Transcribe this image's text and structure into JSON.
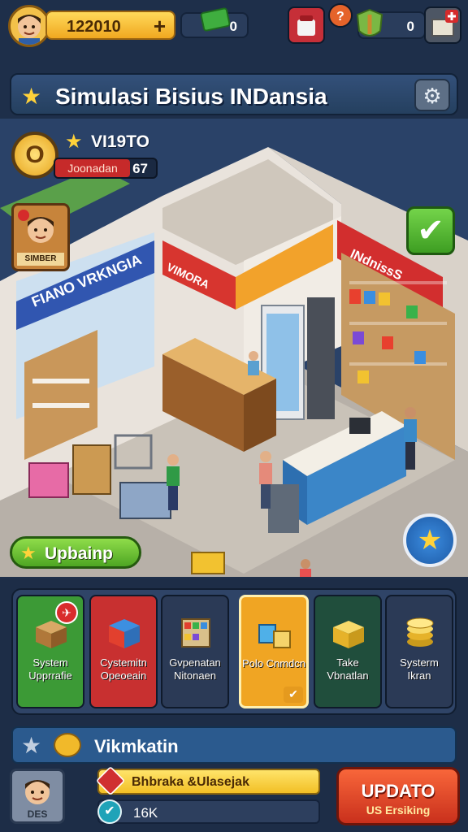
{
  "hud": {
    "coins": "122010",
    "coins_plus": "+",
    "cash": "0",
    "gems": "0"
  },
  "title": {
    "text": "Simulasi Bisius INDansia"
  },
  "player": {
    "name": "VI19TO",
    "level_symbol": "O",
    "rank_label": "Joonadan",
    "rank_value": "67"
  },
  "scene": {
    "staff_name": "SIMBER",
    "sign_left": "FIANO VRKNGIA",
    "sign_mid": "VIMORA",
    "sign_right": "INdnissS"
  },
  "upgrade_pill": {
    "label": "Upbainp"
  },
  "cards": [
    {
      "label": "System Upprrafie",
      "color": "#3c9a36"
    },
    {
      "label": "Cystemitn Opeoeain",
      "color": "#c83030"
    },
    {
      "label": "Gvpenatan Nitonaen",
      "color": "#2b3a56"
    },
    {
      "label": "Polo Cnmdcn",
      "color": "#f0a523"
    },
    {
      "label": "Take Vbnatlan",
      "color": "#204e3c"
    },
    {
      "label": "Systerm Ikran",
      "color": "#2b3a56"
    }
  ],
  "info_bar": {
    "label": "Vikmkatin"
  },
  "footer": {
    "avatar_name": "DES",
    "bar1_label": "Bhbraka &Ulasejak",
    "bar2_label": "16K",
    "update_line1": "UPDATO",
    "update_line2": "US Ersiking"
  }
}
